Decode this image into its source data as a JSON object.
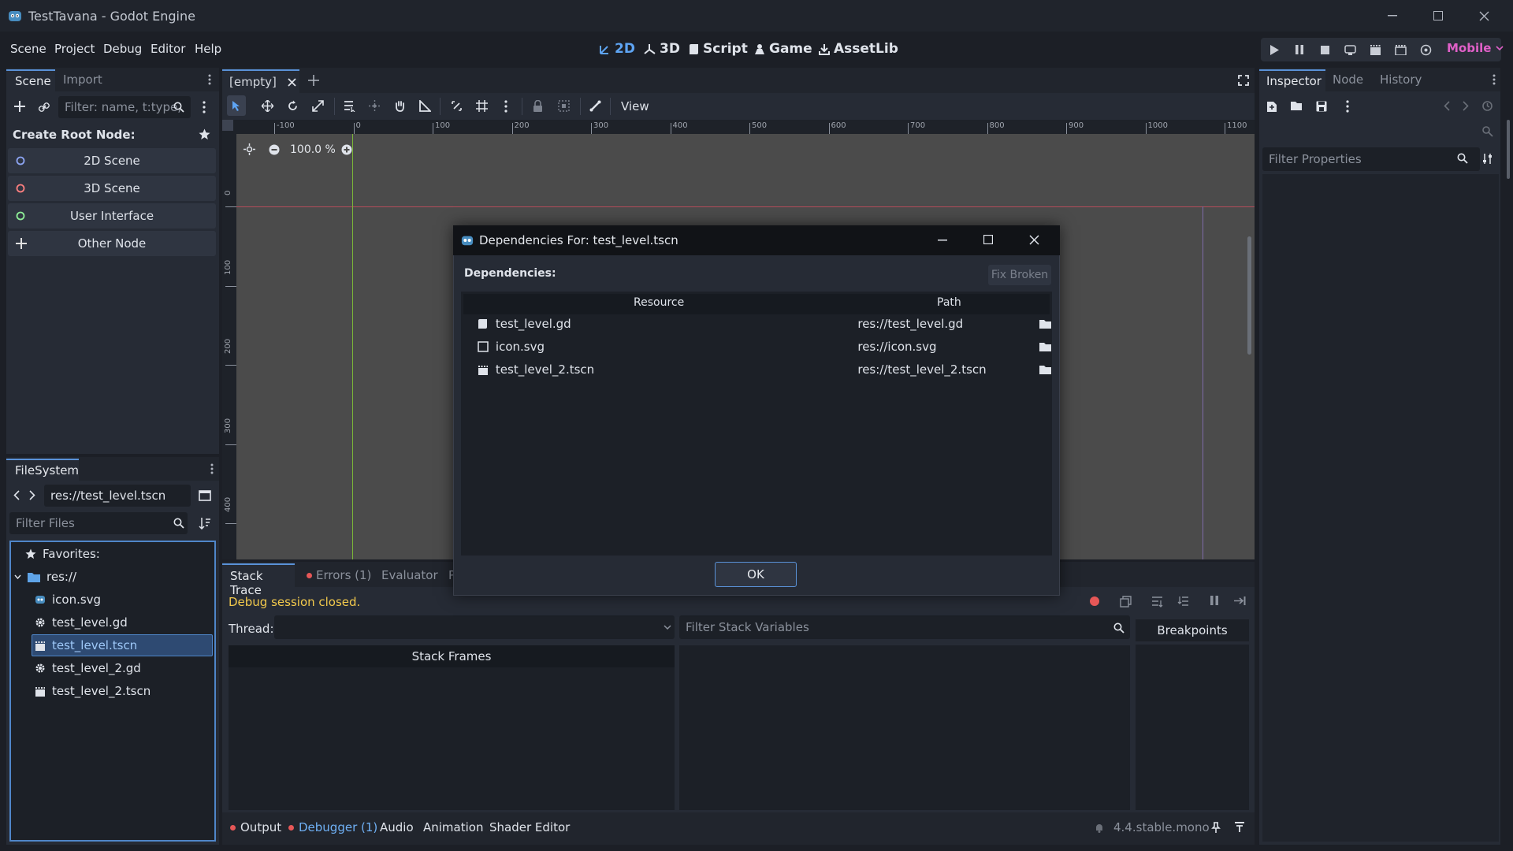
{
  "window": {
    "title": "TestTavana - Godot Engine"
  },
  "menu": [
    "Scene",
    "Project",
    "Debug",
    "Editor",
    "Help"
  ],
  "workspaces": [
    {
      "label": "2D",
      "icon": "2d-icon"
    },
    {
      "label": "3D",
      "icon": "3d-icon"
    },
    {
      "label": "Script",
      "icon": "script-icon"
    },
    {
      "label": "Game",
      "icon": "game-icon"
    },
    {
      "label": "AssetLib",
      "icon": "assetlib-icon"
    }
  ],
  "renderer": "Mobile",
  "scene_dock": {
    "tabs": [
      "Scene",
      "Import"
    ],
    "filter_placeholder": "Filter: name, t:type,",
    "create_root_label": "Create Root Node:",
    "root_options": [
      {
        "label": "2D Scene",
        "color": "#8da5f3"
      },
      {
        "label": "3D Scene",
        "color": "#fc7f7f"
      },
      {
        "label": "User Interface",
        "color": "#8eef97"
      },
      {
        "label": "Other Node",
        "color": "#e0e0e0"
      }
    ]
  },
  "filesystem": {
    "tab": "FileSystem",
    "path": "res://test_level.tscn",
    "filter_placeholder": "Filter Files",
    "favorites_label": "Favorites:",
    "root_label": "res://",
    "files": [
      {
        "name": "icon.svg",
        "icon": "image-icon"
      },
      {
        "name": "test_level.gd",
        "icon": "gear-icon"
      },
      {
        "name": "test_level.tscn",
        "icon": "clapper-icon",
        "selected": true
      },
      {
        "name": "test_level_2.gd",
        "icon": "gear-icon"
      },
      {
        "name": "test_level_2.tscn",
        "icon": "clapper-icon"
      }
    ]
  },
  "editor": {
    "tab_label": "[empty]",
    "view_label": "View",
    "zoom": "100.0 %",
    "ruler_ticks": [
      "-100",
      "0",
      "100",
      "200",
      "300",
      "400",
      "500",
      "600",
      "700",
      "800",
      "900",
      "1000",
      "1100"
    ],
    "vruler_ticks": [
      "0",
      "100",
      "200",
      "300",
      "400"
    ]
  },
  "dialog": {
    "title": "Dependencies For: test_level.tscn",
    "section_label": "Dependencies:",
    "fix_broken": "Fix Broken",
    "col_resource": "Resource",
    "col_path": "Path",
    "rows": [
      {
        "resource": "test_level.gd",
        "path": "res://test_level.gd",
        "icon": "script-file-icon"
      },
      {
        "resource": "icon.svg",
        "path": "res://icon.svg",
        "icon": "image-file-icon"
      },
      {
        "resource": "test_level_2.tscn",
        "path": "res://test_level_2.tscn",
        "icon": "clapper-icon"
      }
    ],
    "ok_label": "OK"
  },
  "debugger": {
    "tabs": [
      "Stack Trace",
      "Errors (1)",
      "Evaluator",
      "P"
    ],
    "status": "Debug session closed.",
    "thread_label": "Thread:",
    "stack_frames": "Stack Frames",
    "filter_vars_placeholder": "Filter Stack Variables",
    "breakpoints": "Breakpoints"
  },
  "bottom_panel": {
    "tabs": [
      "Output",
      "Debugger (1)",
      "Audio",
      "Animation",
      "Shader Editor"
    ],
    "version": "4.4.stable.mono"
  },
  "inspector": {
    "tabs": [
      "Inspector",
      "Node",
      "History"
    ],
    "filter_placeholder": "Filter Properties"
  }
}
